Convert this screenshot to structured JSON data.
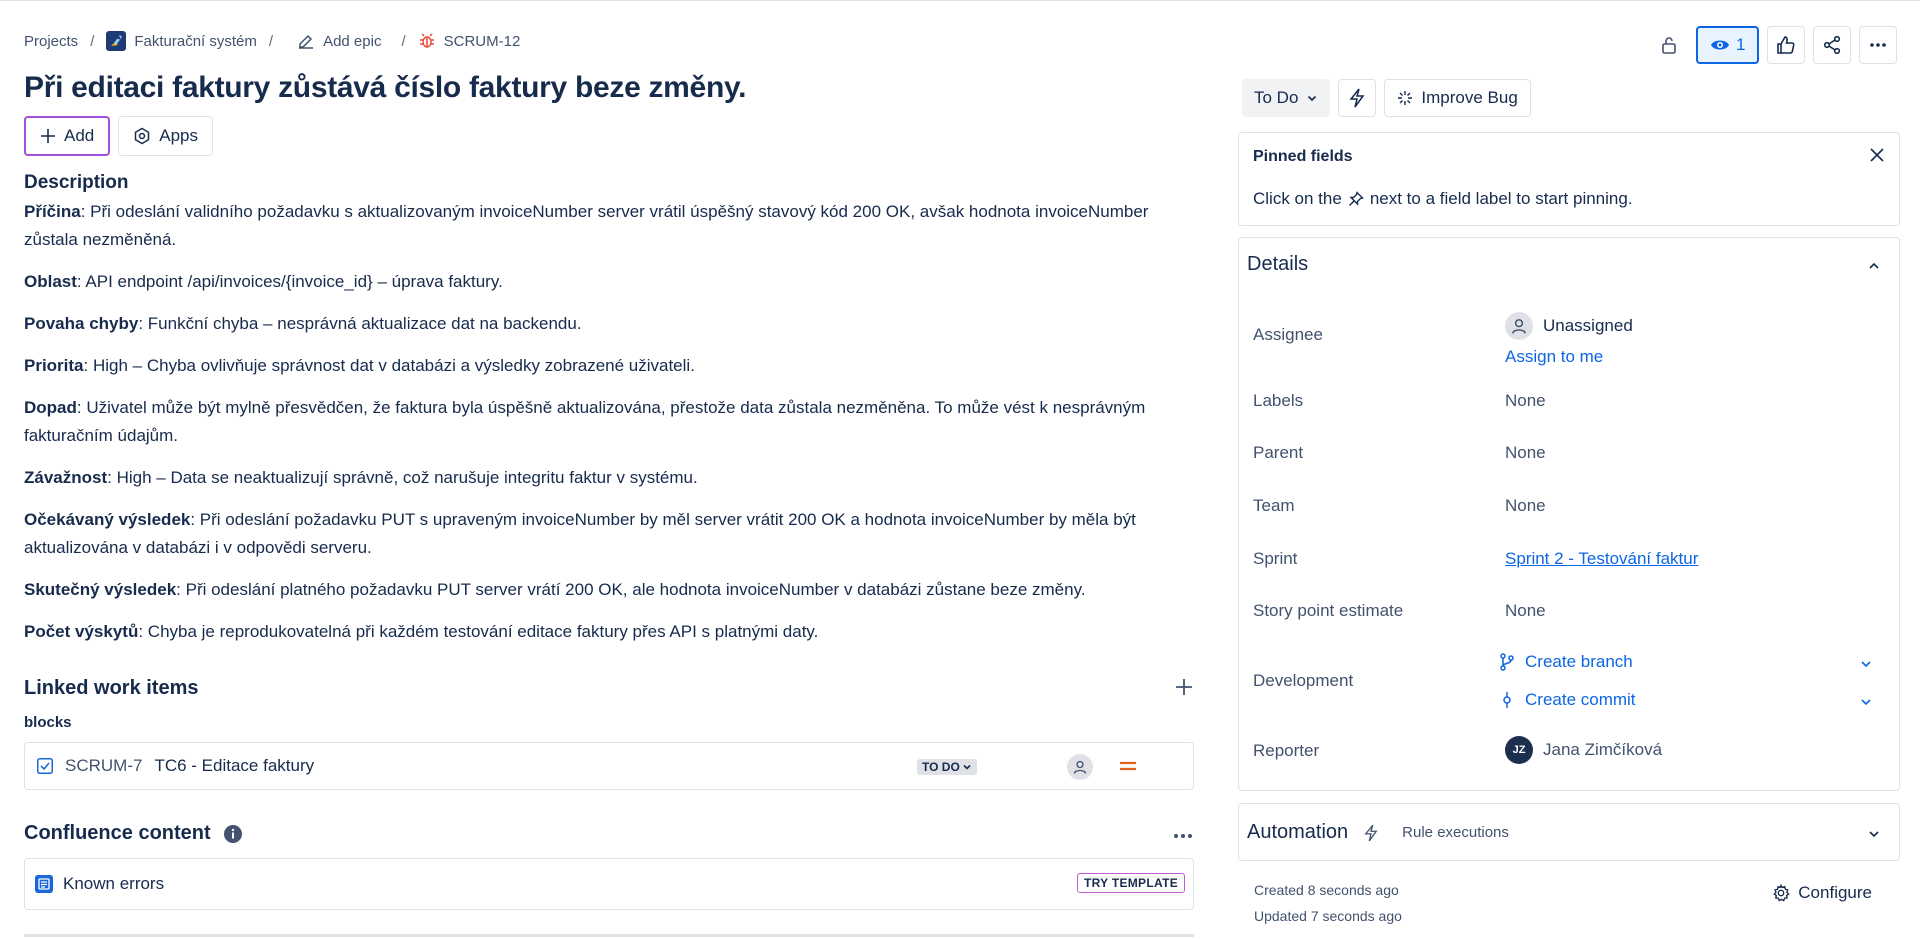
{
  "breadcrumb": {
    "projects": "Projects",
    "project": "Fakturační systém",
    "add_epic": "Add epic",
    "issue_key": "SCRUM-12"
  },
  "issue": {
    "title": "Při editaci faktury zůstává číslo faktury beze změny."
  },
  "actions": {
    "add_label": "Add",
    "apps_label": "Apps"
  },
  "description": {
    "heading": "Description",
    "paragraphs": [
      {
        "label": "Příčina",
        "text": ": Při odeslání validního požadavku s aktualizovaným invoiceNumber server vrátil úspěšný stavový kód 200 OK, avšak hodnota invoi­ceNumber zůstala nezměněná."
      },
      {
        "label": "Oblast",
        "text": ": API endpoint /api/invoices/{invoice_id} – úprava faktury."
      },
      {
        "label": "Povaha chyby",
        "text": ": Funkční chyba – nesprávná aktualizace dat na backendu."
      },
      {
        "label": "Priorita",
        "text": ": High – Chyba ovlivňuje správnost dat v databázi a výsledky zobrazené uživateli."
      },
      {
        "label": "Dopad",
        "text": ": Uživatel může být mylně přesvědčen, že faktura byla úspěšně aktualizována, přestože data zůstala nezměněna. To může vést k nesprávným fakturačním údajům."
      },
      {
        "label": "Závažnost",
        "text": ": High – Data se neaktualizují správně, což narušuje integritu faktur v systému."
      },
      {
        "label": "Očekávaný výsledek",
        "text": ": Při odeslání požadavku PUT s upraveným invoiceNumber by měl server vrátit 200 OK a hodnota invoiceNumber by měla být aktualizována v databázi i v odpovědi serveru."
      },
      {
        "label": "Skutečný výsledek",
        "text": ": Při odeslání platného požadavku PUT server vrátí 200 OK, ale hodnota invoiceNumber v databázi zůstane beze změny."
      },
      {
        "label": "Počet výskytů",
        "text": ": Chyba je reprodukovatelná při každém testování editace faktury přes API s platnými daty."
      }
    ]
  },
  "linked": {
    "heading": "Linked work items",
    "relation": "blocks",
    "item": {
      "key": "SCRUM-7",
      "summary": "TC6 - Editace faktury",
      "status": "TO DO"
    }
  },
  "confluence": {
    "heading": "Confluence content",
    "item_title": "Known errors",
    "try_template": "TRY TEMPLATE"
  },
  "toolbar": {
    "watch_count": "1"
  },
  "status": {
    "current": "To Do",
    "improve_label": "Improve Bug"
  },
  "pinned": {
    "title": "Pinned fields",
    "text_before": "Click on the",
    "text_after": "next to a field label to start pinning."
  },
  "details": {
    "heading": "Details",
    "assignee_label": "Assignee",
    "assignee_value": "Unassigned",
    "assign_to_me": "Assign to me",
    "labels_label": "Labels",
    "labels_value": "None",
    "parent_label": "Parent",
    "parent_value": "None",
    "team_label": "Team",
    "team_value": "None",
    "sprint_label": "Sprint",
    "sprint_value": "Sprint 2 - Testování faktur",
    "story_points_label": "Story point estimate",
    "story_points_value": "None",
    "development_label": "Development",
    "create_branch": "Create branch",
    "create_commit": "Create commit",
    "reporter_label": "Reporter",
    "reporter_initials": "JZ",
    "reporter_value": "Jana Zimčíková"
  },
  "automation": {
    "heading": "Automation",
    "sub": "Rule executions"
  },
  "meta": {
    "created": "Created 8 seconds ago",
    "updated": "Updated 7 seconds ago",
    "configure": "Configure"
  },
  "colors": {
    "link": "#0c66e4",
    "focus_ring": "#a54ed8",
    "priority": "#e2611f",
    "bug_icon": "#e5493a"
  }
}
